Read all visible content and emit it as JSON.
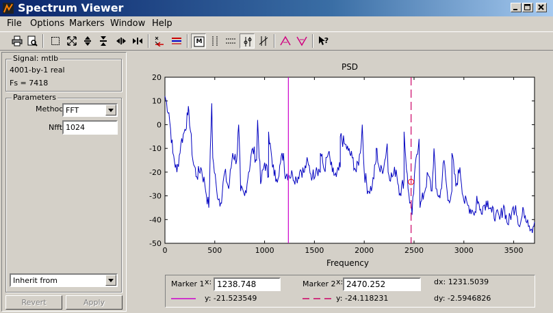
{
  "window": {
    "title": "Spectrum Viewer"
  },
  "menu": [
    "File",
    "Options",
    "Markers",
    "Window",
    "Help"
  ],
  "toolbar": {
    "icons": [
      "print-icon",
      "print-preview-icon",
      "zoom-box-icon",
      "zoom-full-icon",
      "zoom-vertical-in-icon",
      "zoom-vertical-out-icon",
      "zoom-horizontal-in-icon",
      "zoom-horizontal-out-icon",
      "select-trace-icon",
      "overlay-icon",
      "magnitude-spec-icon",
      "vertical-markers-icon",
      "horizontal-markers-icon",
      "track-marker-icon",
      "slope-marker-icon",
      "peaks-icon",
      "valleys-icon",
      "whats-this-icon"
    ]
  },
  "signal": {
    "group_label": "Signal: mtlb",
    "size": "4001-by-1 real",
    "fs": "Fs = 7418"
  },
  "parameters": {
    "group_label": "Parameters",
    "method_label": "Method",
    "method_value": "FFT",
    "nfft_label": "Nfft",
    "nfft_value": "1024",
    "inherit_value": "Inherit from",
    "revert_label": "Revert",
    "apply_label": "Apply"
  },
  "colors": {
    "trace": "#0000c0",
    "marker1": "#cc00cc",
    "marker2": "#cc0066",
    "title_gradient_start": "#0a246a"
  },
  "chart_data": {
    "type": "line",
    "title": "PSD",
    "xlabel": "Frequency",
    "ylabel": "",
    "xlim": [
      0,
      3709
    ],
    "ylim": [
      -50,
      20
    ],
    "xticks": [
      0,
      500,
      1000,
      1500,
      2000,
      2500,
      3000,
      3500
    ],
    "yticks": [
      20,
      10,
      0,
      -10,
      -20,
      -30,
      -40,
      -50
    ],
    "grid": false,
    "series": [
      {
        "x": [
          0,
          40,
          80,
          120,
          160,
          200,
          240,
          280,
          320,
          360,
          400,
          440,
          480,
          520,
          560,
          600,
          640,
          680,
          720,
          760,
          800,
          840,
          880,
          920,
          960,
          1000,
          1040,
          1080,
          1120,
          1160,
          1200,
          1240,
          1280,
          1320,
          1360,
          1400,
          1440,
          1480,
          1520,
          1560,
          1600,
          1640,
          1680,
          1720,
          1760,
          1800,
          1840,
          1880,
          1920,
          1960,
          2000,
          2040,
          2080,
          2120,
          2160,
          2200,
          2240,
          2280,
          2320,
          2360,
          2400,
          2440,
          2480,
          2520,
          2560,
          2600,
          2640,
          2680,
          2720,
          2760,
          2800,
          2840,
          2880,
          2920,
          2960,
          3000,
          3040,
          3080,
          3120,
          3160,
          3200,
          3240,
          3280,
          3320,
          3360,
          3400,
          3440,
          3480,
          3520,
          3560,
          3600,
          3640,
          3680,
          3709
        ],
        "y": [
          12,
          5,
          -12,
          -20,
          -8,
          -2,
          6,
          -15,
          -22,
          -18,
          -25,
          -35,
          -14,
          -28,
          -33,
          -20,
          -27,
          -12,
          -15,
          -28,
          -30,
          -20,
          -10,
          -15,
          -25,
          -16,
          -22,
          -18,
          -23,
          -16,
          -20,
          -21,
          -21,
          -23,
          -19,
          -20,
          -17,
          -22,
          -18,
          -20,
          -19,
          -12,
          -20,
          -22,
          -18,
          -8,
          -11,
          -14,
          -20,
          -12,
          -20,
          -28,
          -26,
          -15,
          -20,
          -17,
          -20,
          -22,
          -19,
          -29,
          -23,
          -27,
          -38,
          -14,
          -35,
          -29,
          -21,
          -28,
          -27,
          -31,
          -15,
          -32,
          -28,
          -26,
          -18,
          -32,
          -34,
          -36,
          -37,
          -36,
          -34,
          -32,
          -37,
          -38,
          -40,
          -34,
          -42,
          -37,
          -34,
          -43,
          -36,
          -40,
          -44,
          -41
        ]
      }
    ],
    "peaks": [
      {
        "x": 230,
        "y": 4
      },
      {
        "x": 470,
        "y": 9
      },
      {
        "x": 740,
        "y": 0
      },
      {
        "x": 930,
        "y": 2
      },
      {
        "x": 1040,
        "y": -3
      },
      {
        "x": 1190,
        "y": -12
      },
      {
        "x": 1420,
        "y": -16
      },
      {
        "x": 1560,
        "y": -12
      },
      {
        "x": 1760,
        "y": -5
      },
      {
        "x": 1980,
        "y": 0
      },
      {
        "x": 2120,
        "y": -10
      },
      {
        "x": 2230,
        "y": -8
      },
      {
        "x": 2400,
        "y": -3
      },
      {
        "x": 2550,
        "y": -6
      },
      {
        "x": 2700,
        "y": -10
      },
      {
        "x": 2880,
        "y": -12
      },
      {
        "x": 3130,
        "y": -30
      }
    ],
    "markers": [
      {
        "name": "Marker 1",
        "x": 1238.748,
        "y": -21.523549
      },
      {
        "name": "Marker 2",
        "x": 2470.252,
        "y": -24.118231
      }
    ]
  },
  "markers_panel": {
    "m1_label": "Marker 1",
    "m1_x_label": "x:",
    "m1_x_value": "1238.748",
    "m1_y_text": "y: -21.523549",
    "m2_label": "Marker 2",
    "m2_x_label": "x:",
    "m2_x_value": "2470.252",
    "m2_y_text": "y: -24.118231",
    "dx_text": "dx: 1231.5039",
    "dy_text": "dy: -2.5946826"
  }
}
